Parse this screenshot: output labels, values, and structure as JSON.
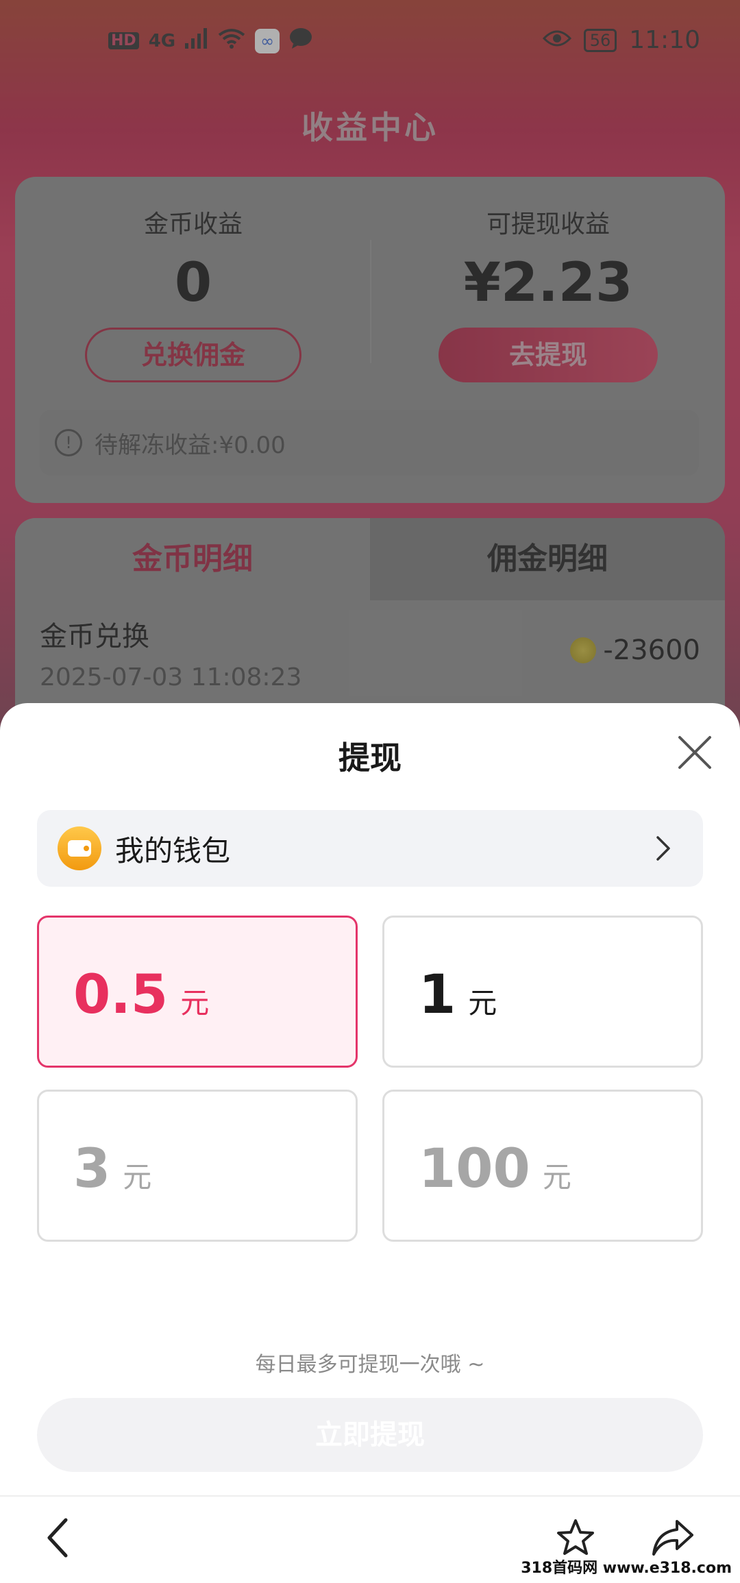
{
  "status_bar": {
    "left_icons": [
      "HD",
      "4G",
      "signal-icon",
      "wifi-icon",
      "app-icon",
      "message-icon"
    ],
    "hd_label": "HD",
    "network_label": "4G",
    "battery": "56",
    "time": "11:10"
  },
  "page": {
    "title": "收益中心"
  },
  "earnings": {
    "coin_label": "金币收益",
    "coin_value": "0",
    "exchange_button": "兑换佣金",
    "cash_label": "可提现收益",
    "cash_value": "¥2.23",
    "withdraw_button": "去提现",
    "pending_text": "待解冻收益:¥0.00"
  },
  "details": {
    "tabs": [
      {
        "label": "金币明细",
        "active": true
      },
      {
        "label": "佣金明细",
        "active": false
      }
    ],
    "records": [
      {
        "title": "金币兑换",
        "time": "2025-07-03 11:08:23",
        "amount": "-23600"
      }
    ]
  },
  "withdraw_sheet": {
    "title": "提现",
    "wallet_label": "我的钱包",
    "unit": "元",
    "amounts": [
      {
        "value": "0.5",
        "state": "selected"
      },
      {
        "value": "1",
        "state": "normal"
      },
      {
        "value": "3",
        "state": "disabled"
      },
      {
        "value": "100",
        "state": "disabled"
      }
    ],
    "hint": "每日最多可提现一次哦 ~",
    "submit_label": "立即提现"
  },
  "colors": {
    "accent": "#e8305e",
    "header_red": "#c9305a",
    "disabled_text": "#a6a6a6"
  },
  "watermark": "318首码网 www.e318.com"
}
